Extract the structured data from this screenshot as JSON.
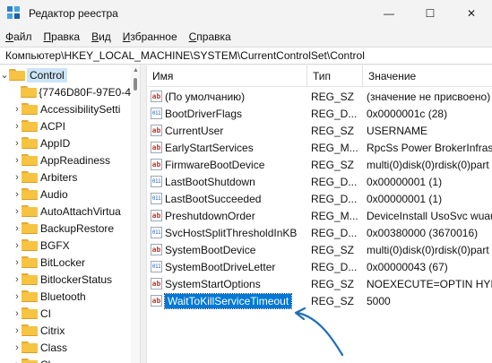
{
  "window": {
    "title": "Редактор реестра",
    "buttons": {
      "minimize": "—",
      "maximize": "☐",
      "close": "✕"
    }
  },
  "menu": [
    {
      "label": "Файл",
      "accel": "Ф",
      "rest": "айл"
    },
    {
      "label": "Правка",
      "accel": "П",
      "rest": "равка"
    },
    {
      "label": "Вид",
      "accel": "В",
      "rest": "ид"
    },
    {
      "label": "Избранное",
      "accel": "И",
      "rest": "збранное"
    },
    {
      "label": "Справка",
      "accel": "С",
      "rest": "правка"
    }
  ],
  "address": "Компьютер\\HKEY_LOCAL_MACHINE\\SYSTEM\\CurrentControlSet\\Control",
  "tree": {
    "root": "Control",
    "children": [
      "{7746D80F-97E0-4",
      "AccessibilitySetti",
      "ACPI",
      "AppID",
      "AppReadiness",
      "Arbiters",
      "Audio",
      "AutoAttachVirtua",
      "BackupRestore",
      "BGFX",
      "BitLocker",
      "BitlockerStatus",
      "Bluetooth",
      "CI",
      "Citrix",
      "Class",
      "Cl"
    ]
  },
  "columns": {
    "name": "Имя",
    "type": "Тип",
    "value": "Значение"
  },
  "rows": [
    {
      "icon": "ab",
      "name": "(По умолчанию)",
      "type": "REG_SZ",
      "value": "(значение не присвоено)"
    },
    {
      "icon": "bin",
      "name": "BootDriverFlags",
      "type": "REG_D...",
      "value": "0x0000001c (28)"
    },
    {
      "icon": "ab",
      "name": "CurrentUser",
      "type": "REG_SZ",
      "value": "USERNAME"
    },
    {
      "icon": "ab",
      "name": "EarlyStartServices",
      "type": "REG_M...",
      "value": "RpcSs Power BrokerInfrast"
    },
    {
      "icon": "ab",
      "name": "FirmwareBootDevice",
      "type": "REG_SZ",
      "value": "multi(0)disk(0)rdisk(0)part"
    },
    {
      "icon": "bin",
      "name": "LastBootShutdown",
      "type": "REG_D...",
      "value": "0x00000001 (1)"
    },
    {
      "icon": "bin",
      "name": "LastBootSucceeded",
      "type": "REG_D...",
      "value": "0x00000001 (1)"
    },
    {
      "icon": "ab",
      "name": "PreshutdownOrder",
      "type": "REG_M...",
      "value": "DeviceInstall UsoSvc wuau"
    },
    {
      "icon": "bin",
      "name": "SvcHostSplitThresholdInKB",
      "type": "REG_D...",
      "value": "0x00380000 (3670016)"
    },
    {
      "icon": "ab",
      "name": "SystemBootDevice",
      "type": "REG_SZ",
      "value": "multi(0)disk(0)rdisk(0)part"
    },
    {
      "icon": "bin",
      "name": "SystemBootDriveLetter",
      "type": "REG_D...",
      "value": "0x00000043 (67)"
    },
    {
      "icon": "ab",
      "name": "SystemStartOptions",
      "type": "REG_SZ",
      "value": " NOEXECUTE=OPTIN  HYI"
    },
    {
      "icon": "ab",
      "name": "WaitToKillServiceTimeout",
      "type": "REG_SZ",
      "value": "5000",
      "selected": true
    }
  ],
  "colors": {
    "accent": "#0078d4",
    "annotation_arrow": "#1f6fb8",
    "folder": "#f6c342"
  },
  "icons": {
    "string_value": "ab-icon",
    "binary_value": "binary-icon",
    "folder": "folder-icon"
  }
}
